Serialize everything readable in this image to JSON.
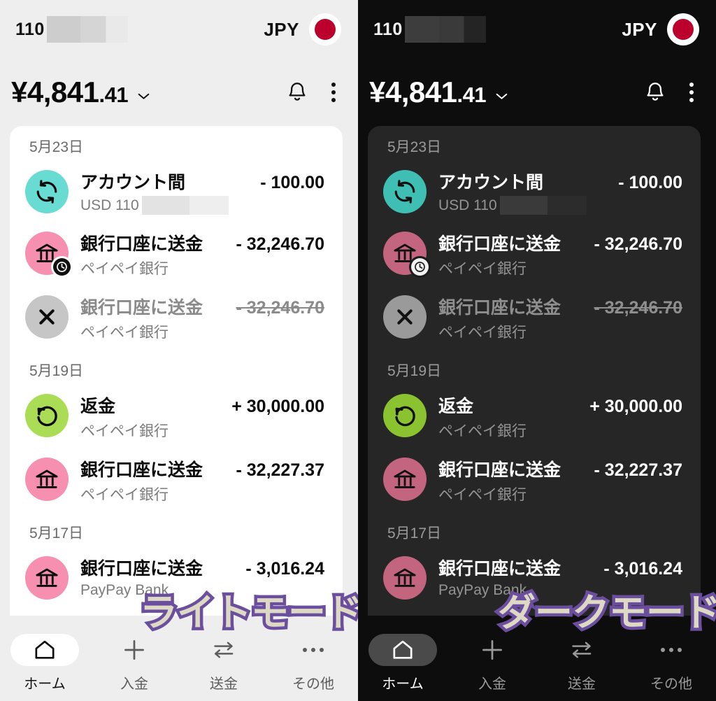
{
  "panels": [
    {
      "theme": "light",
      "watermark": "ライトモード",
      "header": {
        "carrier": "110",
        "currency": "JPY",
        "flag_icon": "japan-flag-icon",
        "flag_color": "#bc002d"
      },
      "balance": {
        "symbol": "¥",
        "whole": "4,841",
        "cents": ".41",
        "chevron_icon": "chevron-down-icon",
        "bell_icon": "bell-icon",
        "overflow_icon": "more-vertical-icon"
      },
      "transactions": {
        "groups": [
          {
            "date": "5月23日",
            "items": [
              {
                "icon": "sync-arrows-icon",
                "icon_bg": "#68dcd2",
                "title": "アカウント間",
                "subtitle": "USD 110",
                "subtitle_redacted": true,
                "amount": "- 100.00",
                "state": "normal",
                "badge": null
              },
              {
                "icon": "bank-icon",
                "icon_bg": "#f78fb0",
                "title": "銀行口座に送金",
                "subtitle": "ペイペイ銀行",
                "subtitle_redacted": false,
                "amount": "- 32,246.70",
                "state": "normal",
                "badge": "clock-icon"
              },
              {
                "icon": "close-x-icon",
                "icon_bg": "#c6c6c6",
                "title": "銀行口座に送金",
                "subtitle": "ペイペイ銀行",
                "subtitle_redacted": false,
                "amount": "- 32,246.70",
                "state": "cancelled",
                "badge": null
              }
            ]
          },
          {
            "date": "5月19日",
            "items": [
              {
                "icon": "refund-rotate-icon",
                "icon_bg": "#aadd55",
                "title": "返金",
                "subtitle": "ペイペイ銀行",
                "subtitle_redacted": false,
                "amount": "+ 30,000.00",
                "state": "normal",
                "badge": null
              },
              {
                "icon": "bank-icon",
                "icon_bg": "#f78fb0",
                "title": "銀行口座に送金",
                "subtitle": "ペイペイ銀行",
                "subtitle_redacted": false,
                "amount": "- 32,227.37",
                "state": "normal",
                "badge": null
              }
            ]
          },
          {
            "date": "5月17日",
            "items": [
              {
                "icon": "bank-icon",
                "icon_bg": "#f78fb0",
                "title": "銀行口座に送金",
                "subtitle": "PayPay Bank",
                "subtitle_redacted": false,
                "amount": "- 3,016.24",
                "state": "normal",
                "badge": null
              }
            ]
          }
        ]
      },
      "nav": [
        {
          "icon": "home-icon",
          "label": "ホーム",
          "active": true
        },
        {
          "icon": "plus-icon",
          "label": "入金",
          "active": false
        },
        {
          "icon": "transfer-arrows-icon",
          "label": "送金",
          "active": false
        },
        {
          "icon": "more-horizontal-icon",
          "label": "その他",
          "active": false
        }
      ]
    },
    {
      "theme": "dark",
      "watermark": "ダークモード",
      "header": {
        "carrier": "110",
        "currency": "JPY",
        "flag_icon": "japan-flag-icon",
        "flag_color": "#bc002d"
      },
      "balance": {
        "symbol": "¥",
        "whole": "4,841",
        "cents": ".41",
        "chevron_icon": "chevron-down-icon",
        "bell_icon": "bell-icon",
        "overflow_icon": "more-vertical-icon"
      },
      "transactions": {
        "groups": [
          {
            "date": "5月23日",
            "items": [
              {
                "icon": "sync-arrows-icon",
                "icon_bg": "#3fbfb3",
                "title": "アカウント間",
                "subtitle": "USD 110",
                "subtitle_redacted": true,
                "amount": "- 100.00",
                "state": "normal",
                "badge": null
              },
              {
                "icon": "bank-icon",
                "icon_bg": "#c4657f",
                "title": "銀行口座に送金",
                "subtitle": "ペイペイ銀行",
                "subtitle_redacted": false,
                "amount": "- 32,246.70",
                "state": "normal",
                "badge": "clock-icon"
              },
              {
                "icon": "close-x-icon",
                "icon_bg": "#9a9a9a",
                "title": "銀行口座に送金",
                "subtitle": "ペイペイ銀行",
                "subtitle_redacted": false,
                "amount": "- 32,246.70",
                "state": "cancelled",
                "badge": null
              }
            ]
          },
          {
            "date": "5月19日",
            "items": [
              {
                "icon": "refund-rotate-icon",
                "icon_bg": "#8ac32f",
                "title": "返金",
                "subtitle": "ペイペイ銀行",
                "subtitle_redacted": false,
                "amount": "+ 30,000.00",
                "state": "normal",
                "badge": null
              },
              {
                "icon": "bank-icon",
                "icon_bg": "#c4657f",
                "title": "銀行口座に送金",
                "subtitle": "ペイペイ銀行",
                "subtitle_redacted": false,
                "amount": "- 32,227.37",
                "state": "normal",
                "badge": null
              }
            ]
          },
          {
            "date": "5月17日",
            "items": [
              {
                "icon": "bank-icon",
                "icon_bg": "#c4657f",
                "title": "銀行口座に送金",
                "subtitle": "PayPay Bank",
                "subtitle_redacted": false,
                "amount": "- 3,016.24",
                "state": "normal",
                "badge": null
              }
            ]
          }
        ]
      },
      "nav": [
        {
          "icon": "home-icon",
          "label": "ホーム",
          "active": true
        },
        {
          "icon": "plus-icon",
          "label": "入金",
          "active": false
        },
        {
          "icon": "transfer-arrows-icon",
          "label": "送金",
          "active": false
        },
        {
          "icon": "more-horizontal-icon",
          "label": "その他",
          "active": false
        }
      ]
    }
  ]
}
